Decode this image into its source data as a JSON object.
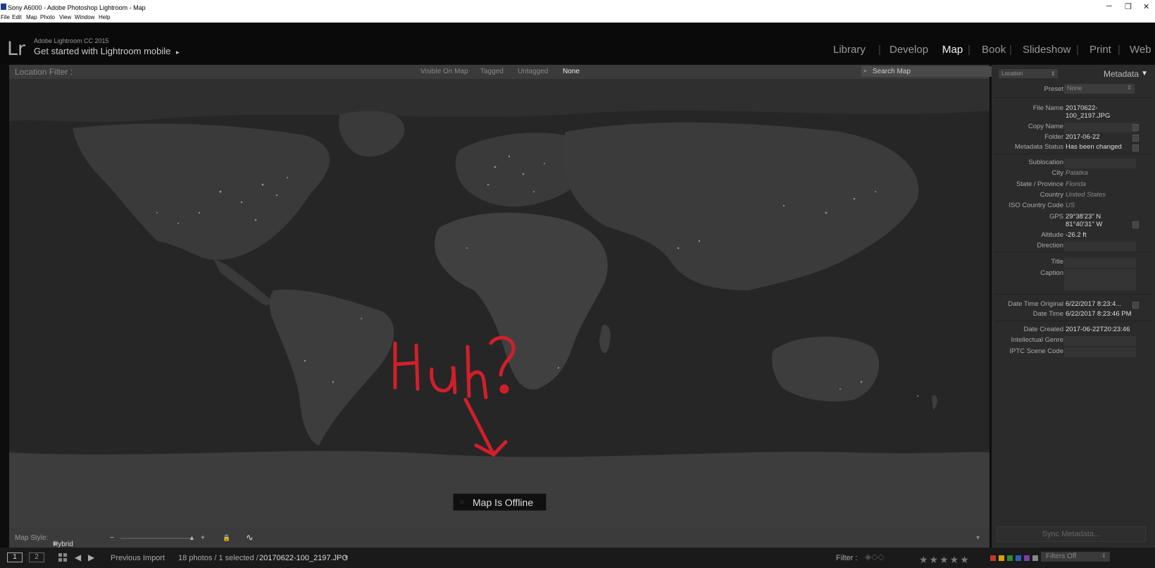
{
  "window": {
    "title": "Sony A6000 - Adobe Photoshop Lightroom - Map",
    "minimize": "─",
    "restore": "❐",
    "close": "✕"
  },
  "menu": [
    "File",
    "Edit",
    "Map",
    "Photo",
    "View",
    "Window",
    "Help"
  ],
  "identity": {
    "logo": "Lr",
    "product": "Adobe Lightroom CC 2015",
    "mobile_prompt": "Get started with Lightroom mobile",
    "mobile_arrow": "▸"
  },
  "modules": {
    "items": [
      "Library",
      "Develop",
      "Map",
      "Book",
      "Slideshow",
      "Print",
      "Web"
    ],
    "active": "Map",
    "separator": "|"
  },
  "location_filter": {
    "label": "Location Filter :",
    "options": [
      "Visible On Map",
      "Tagged",
      "Untagged",
      "None"
    ],
    "selected": "None",
    "search_icon": "⌕",
    "search_placeholder": "Search Map"
  },
  "map": {
    "offline_icon": "◌",
    "offline_text": "Map Is Offline",
    "annotation_text": "Huh?"
  },
  "map_toolbar": {
    "style_label": "Map Style:",
    "style_value": "Hybrid",
    "style_arrow": "⇕",
    "zoom_out": "−",
    "zoom_in": "+",
    "zoom_thumb": "▲",
    "lock_icon": "🔒",
    "tracklog_icon": "∿",
    "collapse_icon": "▾"
  },
  "right_panel": {
    "location_select": "Location",
    "location_arrow": "⇕",
    "title": "Metadata",
    "collapse": "▼",
    "preset_label": "Preset",
    "preset_value": "None",
    "preset_arrow": "⇕",
    "fields": {
      "file_name_label": "File Name",
      "file_name_1": "20170622-",
      "file_name_2": "100_2197.JPG",
      "copy_name_label": "Copy Name",
      "folder_label": "Folder",
      "folder_value": "2017-06-22",
      "meta_status_label": "Metadata Status",
      "meta_status_value": "Has been changed",
      "sublocation_label": "Sublocation",
      "city_label": "City",
      "city_value": "Palatka",
      "state_label": "State / Province",
      "state_value": "Florida",
      "country_label": "Country",
      "country_value": "United States",
      "iso_label": "ISO Country Code",
      "iso_value": "US",
      "gps_label": "GPS",
      "gps_lat": "29°38'23\" N",
      "gps_lon": "81°40'31\" W",
      "altitude_label": "Altitude",
      "altitude_value": "-26.2 ft",
      "direction_label": "Direction",
      "title_label": "Title",
      "caption_label": "Caption",
      "dto_label": "Date Time Original",
      "dto_value": "6/22/2017 8:23:4...",
      "dt_label": "Date Time",
      "dt_value": "6/22/2017 8:23:46 PM",
      "date_created_label": "Date Created",
      "date_created_value": "2017-06-22T20:23:46",
      "genre_label": "Intellectual Genre",
      "scene_label": "IPTC Scene Code"
    },
    "sync_button": "Sync Metadata..."
  },
  "filmstrip": {
    "page1": "1",
    "page2": "2",
    "prev_arrow": "◀",
    "next_arrow": "▶",
    "source": "Previous Import",
    "count": "18 photos / 1 selected /",
    "filename": "20170622-100_2197.JPG",
    "filename_arrow": "▾",
    "filter_label": "Filter :",
    "flags": "◈◇◇",
    "stars": "★★★★★",
    "filters_off": "Filters Off",
    "filters_arrow": "⇕",
    "color_labels": [
      "#c0392b",
      "#d4a017",
      "#2e8b2e",
      "#2b5fb8",
      "#7b3fa0",
      "#888888",
      "#cccccc"
    ]
  }
}
